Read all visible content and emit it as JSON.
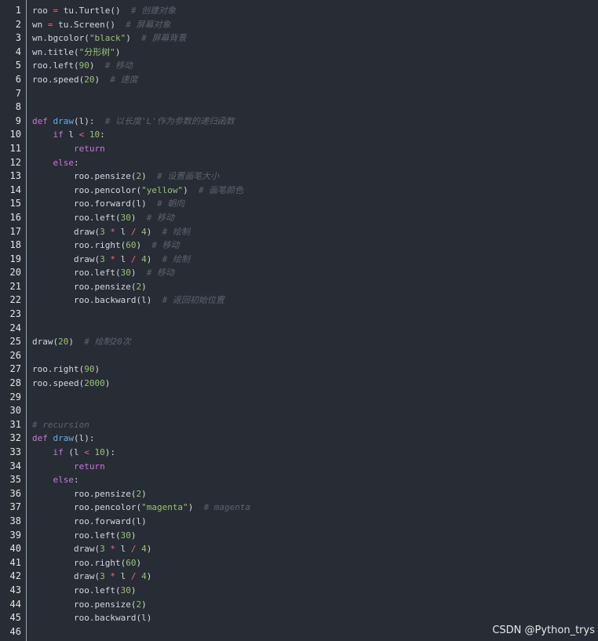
{
  "editor": {
    "lines": [
      {
        "n": "1",
        "tokens": [
          {
            "t": "roo ",
            "c": "plain"
          },
          {
            "t": "=",
            "c": "op"
          },
          {
            "t": " tu.Turtle()  ",
            "c": "plain"
          },
          {
            "t": "# 创建对象",
            "c": "cm"
          }
        ]
      },
      {
        "n": "2",
        "tokens": [
          {
            "t": "wn ",
            "c": "plain"
          },
          {
            "t": "=",
            "c": "op"
          },
          {
            "t": " tu.Screen()  ",
            "c": "plain"
          },
          {
            "t": "# 屏幕对象",
            "c": "cm"
          }
        ]
      },
      {
        "n": "3",
        "tokens": [
          {
            "t": "wn.bgcolor(",
            "c": "plain"
          },
          {
            "t": "\"black\"",
            "c": "str"
          },
          {
            "t": ")  ",
            "c": "plain"
          },
          {
            "t": "# 屏幕背景",
            "c": "cm"
          }
        ]
      },
      {
        "n": "4",
        "tokens": [
          {
            "t": "wn.title(",
            "c": "plain"
          },
          {
            "t": "\"分形树\"",
            "c": "str"
          },
          {
            "t": ")",
            "c": "plain"
          }
        ]
      },
      {
        "n": "5",
        "tokens": [
          {
            "t": "roo.left(",
            "c": "plain"
          },
          {
            "t": "90",
            "c": "num"
          },
          {
            "t": ")  ",
            "c": "plain"
          },
          {
            "t": "# 移动",
            "c": "cm"
          }
        ]
      },
      {
        "n": "6",
        "tokens": [
          {
            "t": "roo.speed(",
            "c": "plain"
          },
          {
            "t": "20",
            "c": "num"
          },
          {
            "t": ")  ",
            "c": "plain"
          },
          {
            "t": "# 速度",
            "c": "cm"
          }
        ]
      },
      {
        "n": "7",
        "tokens": []
      },
      {
        "n": "8",
        "tokens": []
      },
      {
        "n": "9",
        "tokens": [
          {
            "t": "def ",
            "c": "kw"
          },
          {
            "t": "draw",
            "c": "fn"
          },
          {
            "t": "(l):  ",
            "c": "plain"
          },
          {
            "t": "# 以长度'L'作为参数的递归函数",
            "c": "cm"
          }
        ]
      },
      {
        "n": "10",
        "tokens": [
          {
            "t": "    ",
            "c": "plain"
          },
          {
            "t": "if",
            "c": "kw"
          },
          {
            "t": " l ",
            "c": "plain"
          },
          {
            "t": "<",
            "c": "op"
          },
          {
            "t": " ",
            "c": "plain"
          },
          {
            "t": "10",
            "c": "num"
          },
          {
            "t": ":",
            "c": "plain"
          }
        ]
      },
      {
        "n": "11",
        "tokens": [
          {
            "t": "        ",
            "c": "plain"
          },
          {
            "t": "return",
            "c": "kw"
          }
        ]
      },
      {
        "n": "12",
        "tokens": [
          {
            "t": "    ",
            "c": "plain"
          },
          {
            "t": "else",
            "c": "kw"
          },
          {
            "t": ":",
            "c": "plain"
          }
        ]
      },
      {
        "n": "13",
        "tokens": [
          {
            "t": "        roo.pensize(",
            "c": "plain"
          },
          {
            "t": "2",
            "c": "num"
          },
          {
            "t": ")  ",
            "c": "plain"
          },
          {
            "t": "# 设置画笔大小",
            "c": "cm"
          }
        ]
      },
      {
        "n": "14",
        "tokens": [
          {
            "t": "        roo.pencolor(",
            "c": "plain"
          },
          {
            "t": "\"yellow\"",
            "c": "str"
          },
          {
            "t": ")  ",
            "c": "plain"
          },
          {
            "t": "# 画笔颜色",
            "c": "cm"
          }
        ]
      },
      {
        "n": "15",
        "tokens": [
          {
            "t": "        roo.forward(l)  ",
            "c": "plain"
          },
          {
            "t": "# 朝向",
            "c": "cm"
          }
        ]
      },
      {
        "n": "16",
        "tokens": [
          {
            "t": "        roo.left(",
            "c": "plain"
          },
          {
            "t": "30",
            "c": "num"
          },
          {
            "t": ")  ",
            "c": "plain"
          },
          {
            "t": "# 移动",
            "c": "cm"
          }
        ]
      },
      {
        "n": "17",
        "tokens": [
          {
            "t": "        draw(",
            "c": "plain"
          },
          {
            "t": "3",
            "c": "num"
          },
          {
            "t": " ",
            "c": "plain"
          },
          {
            "t": "*",
            "c": "op"
          },
          {
            "t": " l ",
            "c": "plain"
          },
          {
            "t": "/",
            "c": "op"
          },
          {
            "t": " ",
            "c": "plain"
          },
          {
            "t": "4",
            "c": "num"
          },
          {
            "t": ")  ",
            "c": "plain"
          },
          {
            "t": "# 绘制",
            "c": "cm"
          }
        ]
      },
      {
        "n": "18",
        "tokens": [
          {
            "t": "        roo.right(",
            "c": "plain"
          },
          {
            "t": "60",
            "c": "num"
          },
          {
            "t": ")  ",
            "c": "plain"
          },
          {
            "t": "# 移动",
            "c": "cm"
          }
        ]
      },
      {
        "n": "19",
        "tokens": [
          {
            "t": "        draw(",
            "c": "plain"
          },
          {
            "t": "3",
            "c": "num"
          },
          {
            "t": " ",
            "c": "plain"
          },
          {
            "t": "*",
            "c": "op"
          },
          {
            "t": " l ",
            "c": "plain"
          },
          {
            "t": "/",
            "c": "op"
          },
          {
            "t": " ",
            "c": "plain"
          },
          {
            "t": "4",
            "c": "num"
          },
          {
            "t": ")  ",
            "c": "plain"
          },
          {
            "t": "# 绘制",
            "c": "cm"
          }
        ]
      },
      {
        "n": "20",
        "tokens": [
          {
            "t": "        roo.left(",
            "c": "plain"
          },
          {
            "t": "30",
            "c": "num"
          },
          {
            "t": ")  ",
            "c": "plain"
          },
          {
            "t": "# 移动",
            "c": "cm"
          }
        ]
      },
      {
        "n": "21",
        "tokens": [
          {
            "t": "        roo.pensize(",
            "c": "plain"
          },
          {
            "t": "2",
            "c": "num"
          },
          {
            "t": ")",
            "c": "plain"
          }
        ]
      },
      {
        "n": "22",
        "tokens": [
          {
            "t": "        roo.backward(l)  ",
            "c": "plain"
          },
          {
            "t": "# 返回初始位置",
            "c": "cm"
          }
        ]
      },
      {
        "n": "23",
        "tokens": []
      },
      {
        "n": "24",
        "tokens": []
      },
      {
        "n": "25",
        "tokens": [
          {
            "t": "draw(",
            "c": "plain"
          },
          {
            "t": "20",
            "c": "num"
          },
          {
            "t": ")  ",
            "c": "plain"
          },
          {
            "t": "# 绘制20次",
            "c": "cm"
          }
        ]
      },
      {
        "n": "26",
        "tokens": []
      },
      {
        "n": "27",
        "tokens": [
          {
            "t": "roo.right(",
            "c": "plain"
          },
          {
            "t": "90",
            "c": "num"
          },
          {
            "t": ")",
            "c": "plain"
          }
        ]
      },
      {
        "n": "28",
        "tokens": [
          {
            "t": "roo.speed(",
            "c": "plain"
          },
          {
            "t": "2000",
            "c": "num"
          },
          {
            "t": ")",
            "c": "plain"
          }
        ]
      },
      {
        "n": "29",
        "tokens": []
      },
      {
        "n": "30",
        "tokens": []
      },
      {
        "n": "31",
        "tokens": [
          {
            "t": "# recursion",
            "c": "cm"
          }
        ]
      },
      {
        "n": "32",
        "tokens": [
          {
            "t": "def ",
            "c": "kw"
          },
          {
            "t": "draw",
            "c": "fn"
          },
          {
            "t": "(l):",
            "c": "plain"
          }
        ]
      },
      {
        "n": "33",
        "tokens": [
          {
            "t": "    ",
            "c": "plain"
          },
          {
            "t": "if",
            "c": "kw"
          },
          {
            "t": " (l ",
            "c": "plain"
          },
          {
            "t": "<",
            "c": "op"
          },
          {
            "t": " ",
            "c": "plain"
          },
          {
            "t": "10",
            "c": "num"
          },
          {
            "t": "):",
            "c": "plain"
          }
        ]
      },
      {
        "n": "34",
        "tokens": [
          {
            "t": "        ",
            "c": "plain"
          },
          {
            "t": "return",
            "c": "kw"
          }
        ]
      },
      {
        "n": "35",
        "tokens": [
          {
            "t": "    ",
            "c": "plain"
          },
          {
            "t": "else",
            "c": "kw"
          },
          {
            "t": ":",
            "c": "plain"
          }
        ]
      },
      {
        "n": "36",
        "tokens": [
          {
            "t": "        roo.pensize(",
            "c": "plain"
          },
          {
            "t": "2",
            "c": "num"
          },
          {
            "t": ")",
            "c": "plain"
          }
        ]
      },
      {
        "n": "37",
        "tokens": [
          {
            "t": "        roo.pencolor(",
            "c": "plain"
          },
          {
            "t": "\"magenta\"",
            "c": "str"
          },
          {
            "t": ")  ",
            "c": "plain"
          },
          {
            "t": "# magenta",
            "c": "cm"
          }
        ]
      },
      {
        "n": "38",
        "tokens": [
          {
            "t": "        roo.forward(l)",
            "c": "plain"
          }
        ]
      },
      {
        "n": "39",
        "tokens": [
          {
            "t": "        roo.left(",
            "c": "plain"
          },
          {
            "t": "30",
            "c": "num"
          },
          {
            "t": ")",
            "c": "plain"
          }
        ]
      },
      {
        "n": "40",
        "tokens": [
          {
            "t": "        draw(",
            "c": "plain"
          },
          {
            "t": "3",
            "c": "num"
          },
          {
            "t": " ",
            "c": "plain"
          },
          {
            "t": "*",
            "c": "op"
          },
          {
            "t": " l ",
            "c": "plain"
          },
          {
            "t": "/",
            "c": "op"
          },
          {
            "t": " ",
            "c": "plain"
          },
          {
            "t": "4",
            "c": "num"
          },
          {
            "t": ")",
            "c": "plain"
          }
        ]
      },
      {
        "n": "41",
        "tokens": [
          {
            "t": "        roo.right(",
            "c": "plain"
          },
          {
            "t": "60",
            "c": "num"
          },
          {
            "t": ")",
            "c": "plain"
          }
        ]
      },
      {
        "n": "42",
        "tokens": [
          {
            "t": "        draw(",
            "c": "plain"
          },
          {
            "t": "3",
            "c": "num"
          },
          {
            "t": " ",
            "c": "plain"
          },
          {
            "t": "*",
            "c": "op"
          },
          {
            "t": " l ",
            "c": "plain"
          },
          {
            "t": "/",
            "c": "op"
          },
          {
            "t": " ",
            "c": "plain"
          },
          {
            "t": "4",
            "c": "num"
          },
          {
            "t": ")",
            "c": "plain"
          }
        ]
      },
      {
        "n": "43",
        "tokens": [
          {
            "t": "        roo.left(",
            "c": "plain"
          },
          {
            "t": "30",
            "c": "num"
          },
          {
            "t": ")",
            "c": "plain"
          }
        ]
      },
      {
        "n": "44",
        "tokens": [
          {
            "t": "        roo.pensize(",
            "c": "plain"
          },
          {
            "t": "2",
            "c": "num"
          },
          {
            "t": ")",
            "c": "plain"
          }
        ]
      },
      {
        "n": "45",
        "tokens": [
          {
            "t": "        roo.backward(l)",
            "c": "plain"
          }
        ]
      },
      {
        "n": "46",
        "tokens": []
      }
    ]
  },
  "watermark": {
    "text": "CSDN @Python_trys"
  }
}
